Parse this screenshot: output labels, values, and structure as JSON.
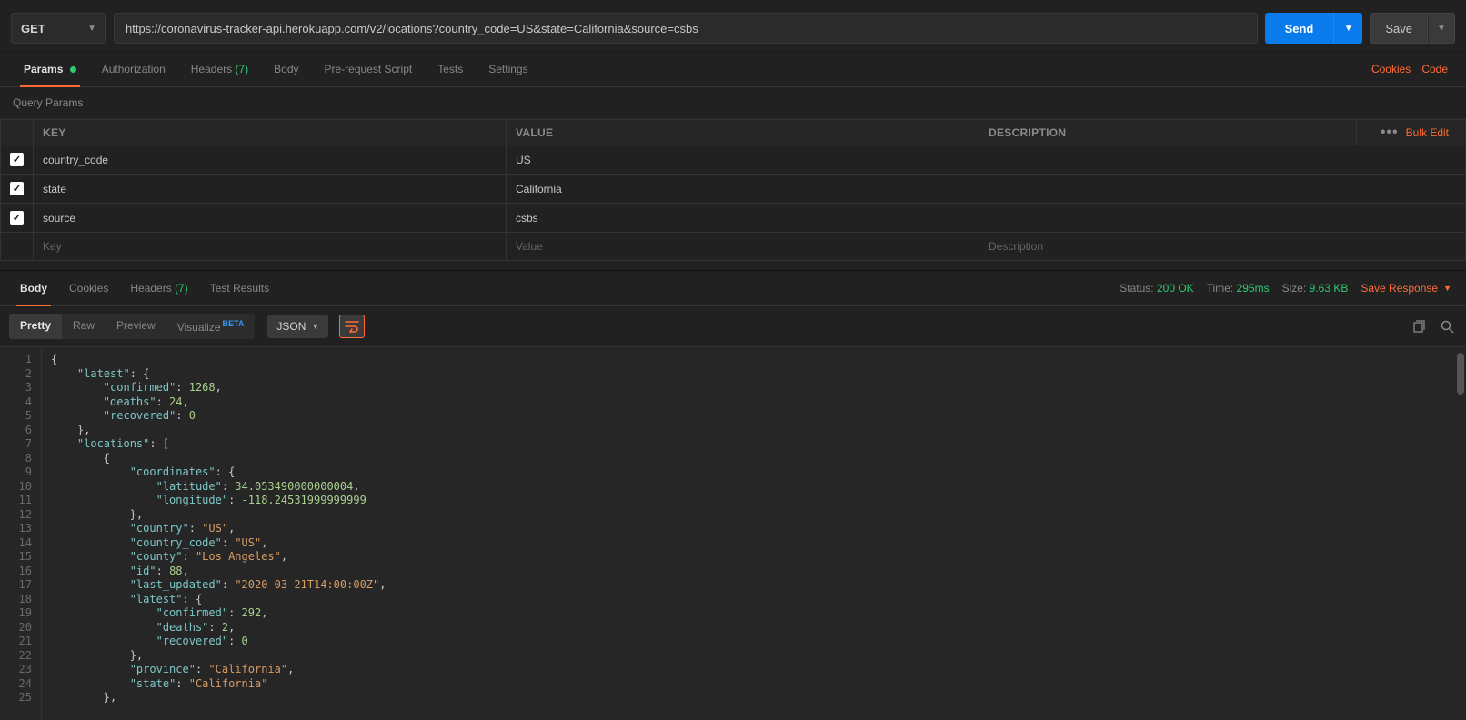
{
  "request": {
    "method": "GET",
    "url": "https://coronavirus-tracker-api.herokuapp.com/v2/locations?country_code=US&state=California&source=csbs",
    "send_label": "Send",
    "save_label": "Save"
  },
  "request_tabs": {
    "params": "Params",
    "authorization": "Authorization",
    "headers": "Headers",
    "headers_count": "(7)",
    "body": "Body",
    "prerequest": "Pre-request Script",
    "tests": "Tests",
    "settings": "Settings"
  },
  "links": {
    "cookies": "Cookies",
    "code": "Code"
  },
  "params_section_title": "Query Params",
  "params_headers": {
    "key": "KEY",
    "value": "VALUE",
    "description": "DESCRIPTION",
    "bulk_edit": "Bulk Edit"
  },
  "params": [
    {
      "enabled": true,
      "key": "country_code",
      "value": "US",
      "description": ""
    },
    {
      "enabled": true,
      "key": "state",
      "value": "California",
      "description": ""
    },
    {
      "enabled": true,
      "key": "source",
      "value": "csbs",
      "description": ""
    }
  ],
  "params_placeholders": {
    "key": "Key",
    "value": "Value",
    "description": "Description"
  },
  "response_tabs": {
    "body": "Body",
    "cookies": "Cookies",
    "headers": "Headers",
    "headers_count": "(7)",
    "test_results": "Test Results"
  },
  "response_meta": {
    "status_label": "Status:",
    "status_value": "200 OK",
    "time_label": "Time:",
    "time_value": "295ms",
    "size_label": "Size:",
    "size_value": "9.63 KB",
    "save_response": "Save Response"
  },
  "body_toolbar": {
    "pretty": "Pretty",
    "raw": "Raw",
    "preview": "Preview",
    "visualize": "Visualize",
    "visualize_badge": "BETA",
    "format": "JSON"
  },
  "code_lines": [
    [
      {
        "c": "p",
        "t": "{"
      }
    ],
    [
      {
        "c": "p",
        "t": "    "
      },
      {
        "c": "k",
        "t": "\"latest\""
      },
      {
        "c": "p",
        "t": ": {"
      }
    ],
    [
      {
        "c": "p",
        "t": "        "
      },
      {
        "c": "k",
        "t": "\"confirmed\""
      },
      {
        "c": "p",
        "t": ": "
      },
      {
        "c": "n",
        "t": "1268"
      },
      {
        "c": "p",
        "t": ","
      }
    ],
    [
      {
        "c": "p",
        "t": "        "
      },
      {
        "c": "k",
        "t": "\"deaths\""
      },
      {
        "c": "p",
        "t": ": "
      },
      {
        "c": "n",
        "t": "24"
      },
      {
        "c": "p",
        "t": ","
      }
    ],
    [
      {
        "c": "p",
        "t": "        "
      },
      {
        "c": "k",
        "t": "\"recovered\""
      },
      {
        "c": "p",
        "t": ": "
      },
      {
        "c": "n",
        "t": "0"
      }
    ],
    [
      {
        "c": "p",
        "t": "    },"
      }
    ],
    [
      {
        "c": "p",
        "t": "    "
      },
      {
        "c": "k",
        "t": "\"locations\""
      },
      {
        "c": "p",
        "t": ": ["
      }
    ],
    [
      {
        "c": "p",
        "t": "        {"
      }
    ],
    [
      {
        "c": "p",
        "t": "            "
      },
      {
        "c": "k",
        "t": "\"coordinates\""
      },
      {
        "c": "p",
        "t": ": {"
      }
    ],
    [
      {
        "c": "p",
        "t": "                "
      },
      {
        "c": "k",
        "t": "\"latitude\""
      },
      {
        "c": "p",
        "t": ": "
      },
      {
        "c": "n",
        "t": "34.053490000000004"
      },
      {
        "c": "p",
        "t": ","
      }
    ],
    [
      {
        "c": "p",
        "t": "                "
      },
      {
        "c": "k",
        "t": "\"longitude\""
      },
      {
        "c": "p",
        "t": ": "
      },
      {
        "c": "n",
        "t": "-118.24531999999999"
      }
    ],
    [
      {
        "c": "p",
        "t": "            },"
      }
    ],
    [
      {
        "c": "p",
        "t": "            "
      },
      {
        "c": "k",
        "t": "\"country\""
      },
      {
        "c": "p",
        "t": ": "
      },
      {
        "c": "s",
        "t": "\"US\""
      },
      {
        "c": "p",
        "t": ","
      }
    ],
    [
      {
        "c": "p",
        "t": "            "
      },
      {
        "c": "k",
        "t": "\"country_code\""
      },
      {
        "c": "p",
        "t": ": "
      },
      {
        "c": "s",
        "t": "\"US\""
      },
      {
        "c": "p",
        "t": ","
      }
    ],
    [
      {
        "c": "p",
        "t": "            "
      },
      {
        "c": "k",
        "t": "\"county\""
      },
      {
        "c": "p",
        "t": ": "
      },
      {
        "c": "s",
        "t": "\"Los Angeles\""
      },
      {
        "c": "p",
        "t": ","
      }
    ],
    [
      {
        "c": "p",
        "t": "            "
      },
      {
        "c": "k",
        "t": "\"id\""
      },
      {
        "c": "p",
        "t": ": "
      },
      {
        "c": "n",
        "t": "88"
      },
      {
        "c": "p",
        "t": ","
      }
    ],
    [
      {
        "c": "p",
        "t": "            "
      },
      {
        "c": "k",
        "t": "\"last_updated\""
      },
      {
        "c": "p",
        "t": ": "
      },
      {
        "c": "s",
        "t": "\"2020-03-21T14:00:00Z\""
      },
      {
        "c": "p",
        "t": ","
      }
    ],
    [
      {
        "c": "p",
        "t": "            "
      },
      {
        "c": "k",
        "t": "\"latest\""
      },
      {
        "c": "p",
        "t": ": {"
      }
    ],
    [
      {
        "c": "p",
        "t": "                "
      },
      {
        "c": "k",
        "t": "\"confirmed\""
      },
      {
        "c": "p",
        "t": ": "
      },
      {
        "c": "n",
        "t": "292"
      },
      {
        "c": "p",
        "t": ","
      }
    ],
    [
      {
        "c": "p",
        "t": "                "
      },
      {
        "c": "k",
        "t": "\"deaths\""
      },
      {
        "c": "p",
        "t": ": "
      },
      {
        "c": "n",
        "t": "2"
      },
      {
        "c": "p",
        "t": ","
      }
    ],
    [
      {
        "c": "p",
        "t": "                "
      },
      {
        "c": "k",
        "t": "\"recovered\""
      },
      {
        "c": "p",
        "t": ": "
      },
      {
        "c": "n",
        "t": "0"
      }
    ],
    [
      {
        "c": "p",
        "t": "            },"
      }
    ],
    [
      {
        "c": "p",
        "t": "            "
      },
      {
        "c": "k",
        "t": "\"province\""
      },
      {
        "c": "p",
        "t": ": "
      },
      {
        "c": "s",
        "t": "\"California\""
      },
      {
        "c": "p",
        "t": ","
      }
    ],
    [
      {
        "c": "p",
        "t": "            "
      },
      {
        "c": "k",
        "t": "\"state\""
      },
      {
        "c": "p",
        "t": ": "
      },
      {
        "c": "s",
        "t": "\"California\""
      }
    ],
    [
      {
        "c": "p",
        "t": "        },"
      }
    ]
  ]
}
